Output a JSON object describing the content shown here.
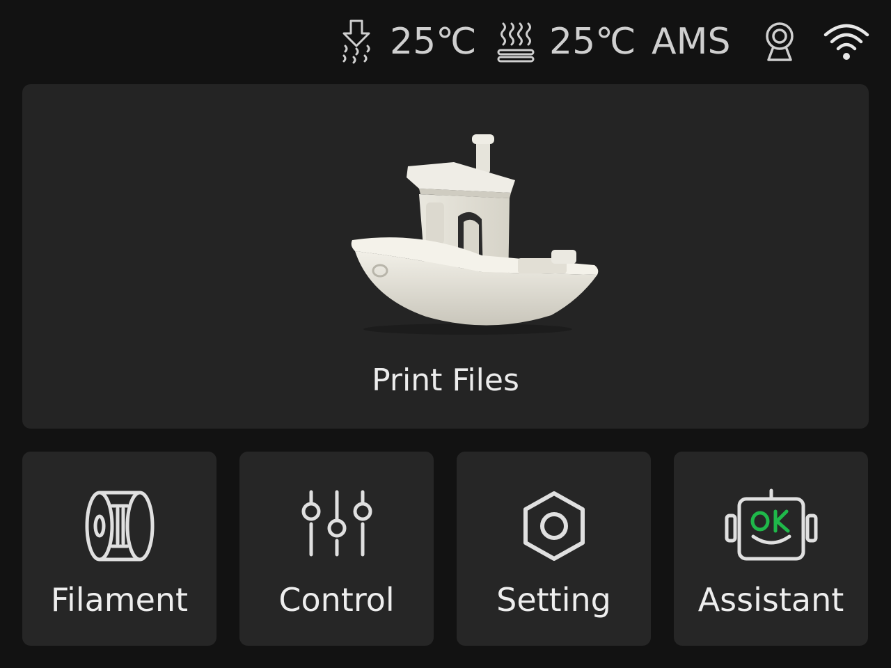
{
  "status_bar": {
    "nozzle_temp": "25℃",
    "bed_temp": "25℃",
    "ams_label": "AMS",
    "icons": [
      "nozzle-heat-icon",
      "heatbed-icon",
      "camera-icon",
      "wifi-icon"
    ]
  },
  "hero": {
    "label": "Print Files",
    "image": "benchy-boat-model"
  },
  "tiles": [
    {
      "label": "Filament",
      "icon": "filament-spool-icon"
    },
    {
      "label": "Control",
      "icon": "sliders-icon"
    },
    {
      "label": "Setting",
      "icon": "hex-nut-icon"
    },
    {
      "label": "Assistant",
      "icon": "robot-ok-icon"
    }
  ],
  "colors": {
    "background": "#121212",
    "card": "#242424",
    "text": "#ececec",
    "status_text": "#cfcfcf",
    "accent_green": "#1fb84a"
  }
}
